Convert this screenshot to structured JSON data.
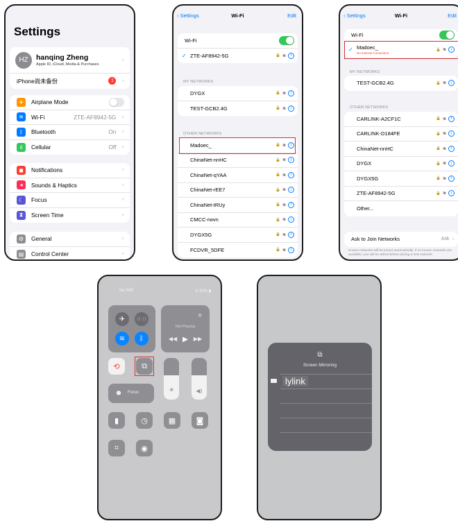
{
  "settings": {
    "title": "Settings",
    "account": {
      "initials": "HZ",
      "name": "hanqing Zheng",
      "subtitle": "Apple ID, iCloud, Media & Purchases"
    },
    "backup": {
      "label": "iPhone尚未备份",
      "badge": "1"
    },
    "group1": [
      {
        "label": "Airplane Mode",
        "icon": "airplane-icon",
        "color": "#ff9500",
        "glyph": "✈",
        "toggle": "off"
      },
      {
        "label": "Wi-Fi",
        "icon": "wifi-icon",
        "color": "#007aff",
        "glyph": "≋",
        "value": "ZTE-AF8942-5G"
      },
      {
        "label": "Bluetooth",
        "icon": "bluetooth-icon",
        "color": "#007aff",
        "glyph": "ᛒ",
        "value": "On"
      },
      {
        "label": "Cellular",
        "icon": "cellular-icon",
        "color": "#34c759",
        "glyph": "ıl",
        "value": "Off"
      }
    ],
    "group2": [
      {
        "label": "Notifications",
        "icon": "notifications-icon",
        "color": "#ff3b30",
        "glyph": "◼"
      },
      {
        "label": "Sounds & Haptics",
        "icon": "sounds-icon",
        "color": "#ff2d55",
        "glyph": "◂"
      },
      {
        "label": "Focus",
        "icon": "moon-icon",
        "color": "#5856d6",
        "glyph": "☾"
      },
      {
        "label": "Screen Time",
        "icon": "hourglass-icon",
        "color": "#5856d6",
        "glyph": "⧗"
      }
    ],
    "group3": [
      {
        "label": "General",
        "icon": "gear-icon",
        "color": "#8e8e93",
        "glyph": "⚙"
      },
      {
        "label": "Control Center",
        "icon": "switches-icon",
        "color": "#8e8e93",
        "glyph": "▤"
      }
    ]
  },
  "wifi1": {
    "back": "Settings",
    "title": "Wi-Fi",
    "edit": "Edit",
    "wifi_label": "Wi-Fi",
    "connected": "ZTE-AF8942-5G",
    "my_networks_header": "MY NETWORKS",
    "my_networks": [
      "DYGX",
      "TEST-GCB2.4G"
    ],
    "other_header": "OTHER NETWORKS",
    "other_networks": [
      "Madoec_",
      "ChinaNet-nnHC",
      "ChinaNet-qYAA",
      "ChinaNet-rEE7",
      "ChinaNet-tRUy",
      "CMCC-rwvn",
      "DYGX5G",
      "FCDVR_5DFE"
    ]
  },
  "wifi2": {
    "back": "Settings",
    "title": "Wi-Fi",
    "edit": "Edit",
    "wifi_label": "Wi-Fi",
    "connected": "Madoec_",
    "connected_status": "No Internet Connection",
    "my_networks_header": "MY NETWORKS",
    "my_networks": [
      "TEST-GCB2.4G"
    ],
    "other_header": "OTHER NETWORKS",
    "other_networks": [
      "CARLINK-A2CF1C",
      "CARLINK-D184FE",
      "ChinaNet-nnHC",
      "DYGX",
      "DYGX5G",
      "ZTE-AF8942-5G",
      "Other..."
    ],
    "ask_label": "Ask to Join Networks",
    "ask_value": "Ask",
    "ask_note": "Known networks will be joined automatically. If no known networks are available, you will be asked before joining a new network."
  },
  "control_center": {
    "carrier": "No SIM",
    "battery": "22%",
    "now_playing": "Not Playing",
    "focus_label": "Focus"
  },
  "mirroring": {
    "title": "Screen Mirroring",
    "device": "lylink"
  }
}
